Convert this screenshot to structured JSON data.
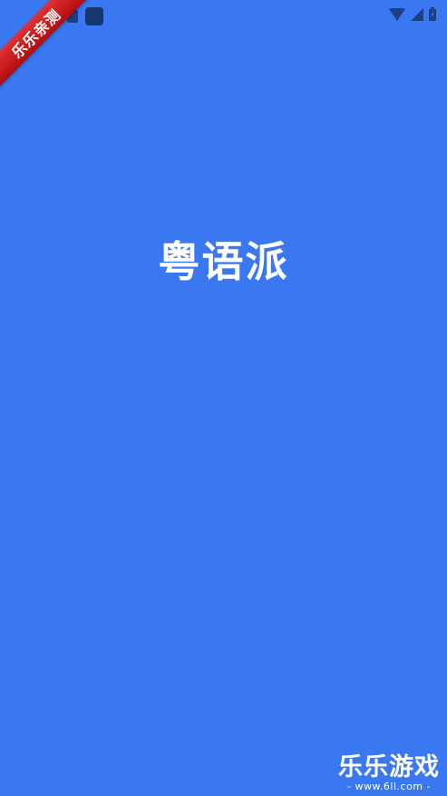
{
  "app": {
    "splash_title": "粤语派"
  },
  "status_bar": {
    "left_icons": [
      "notification-icon",
      "app-icon"
    ],
    "right_icons": [
      "wifi-icon",
      "signal-icon",
      "battery-icon"
    ],
    "colors": {
      "background": "#3a78f2",
      "icon": "#1f3f83"
    }
  },
  "ribbon": {
    "label": "乐乐亲测",
    "color": "#c81c1c"
  },
  "watermark": {
    "name": "乐乐游戏",
    "url": "- www.6ll.com -"
  }
}
